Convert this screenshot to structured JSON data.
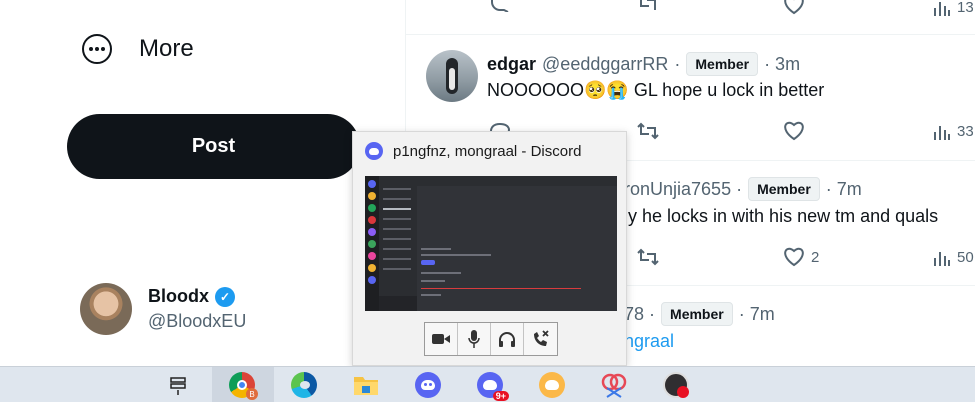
{
  "nav": {
    "more_label": "More",
    "post_label": "Post"
  },
  "profile": {
    "name": "Bloodx",
    "handle": "@BloodxEU"
  },
  "top_actions": {
    "views": "13"
  },
  "tweets": [
    {
      "name": "edgar",
      "handle": "@eeddggarrRR",
      "badge": "Member",
      "time": "· 3m",
      "text": "NOOOOOO🥺😭 GL hope u lock in better",
      "views": "33"
    },
    {
      "handle_partial": "ronUnjia7655 ·",
      "badge": "Member",
      "time": "· 7m",
      "text_partial": "ly he locks in with his new tm and quals",
      "likes": "2",
      "views": "50"
    },
    {
      "handle_partial": "78 ·",
      "badge": "Member",
      "time": "· 7m",
      "link_partial": "ngraal"
    }
  ],
  "discord_preview": {
    "title": "p1ngfnz, mongraal - Discord",
    "controls": [
      "camera-icon",
      "microphone-icon",
      "headphones-icon",
      "leave-call-icon"
    ]
  },
  "taskbar": {
    "items": [
      "task-view-icon",
      "chrome-icon",
      "edge-icon",
      "file-explorer-icon",
      "discord-icon",
      "discord-ptb-icon",
      "discord-canary-icon",
      "snipping-tool-icon",
      "obs-icon"
    ],
    "notification_badge": "9+",
    "chrome_profile_letter": "B"
  },
  "colors": {
    "accent": "#1d9bf0",
    "discord": "#5865f2",
    "post_button": "#0f1419"
  }
}
